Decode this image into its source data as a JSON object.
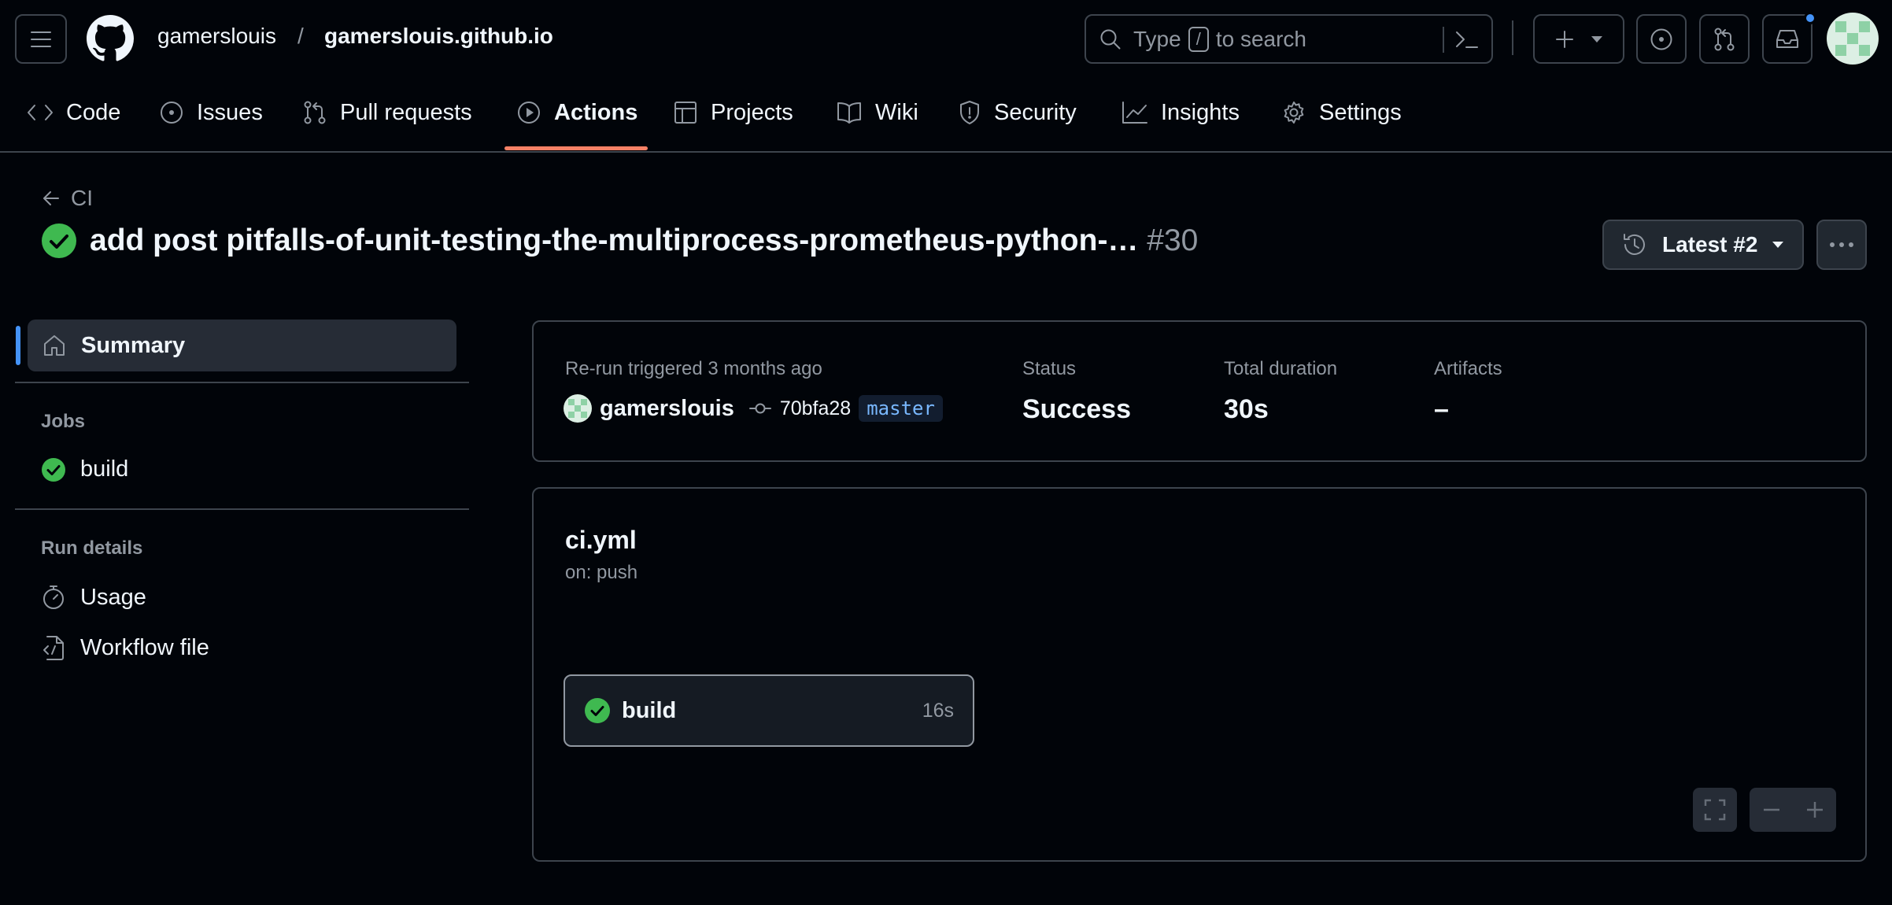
{
  "header": {
    "owner": "gamerslouis",
    "separator": "/",
    "repo": "gamerslouis.github.io",
    "search_prefix": "Type",
    "search_key": "/",
    "search_suffix": "to search"
  },
  "tabs": [
    {
      "label": "Code"
    },
    {
      "label": "Issues"
    },
    {
      "label": "Pull requests"
    },
    {
      "label": "Actions"
    },
    {
      "label": "Projects"
    },
    {
      "label": "Wiki"
    },
    {
      "label": "Security"
    },
    {
      "label": "Insights"
    },
    {
      "label": "Settings"
    }
  ],
  "run": {
    "back_label": "CI",
    "title": "add post pitfalls-of-unit-testing-the-multiprocess-prometheus-python-…",
    "number": "#30",
    "attempt_label": "Latest #2"
  },
  "sidebar": {
    "summary_label": "Summary",
    "jobs_heading": "Jobs",
    "jobs": [
      {
        "label": "build"
      }
    ],
    "details_heading": "Run details",
    "details": [
      {
        "label": "Usage"
      },
      {
        "label": "Workflow file"
      }
    ]
  },
  "summary": {
    "trigger_text": "Re-run triggered 3 months ago",
    "actor": "gamerslouis",
    "commit": "70bfa28",
    "branch": "master",
    "status_label": "Status",
    "status_value": "Success",
    "duration_label": "Total duration",
    "duration_value": "30s",
    "artifacts_label": "Artifacts",
    "artifacts_value": "–"
  },
  "workflow": {
    "file": "ci.yml",
    "trigger": "on: push",
    "jobs": [
      {
        "name": "build",
        "duration": "16s"
      }
    ]
  },
  "colors": {
    "success": "#3fb950",
    "accent": "#4493f8",
    "tab_underline": "#f78166",
    "notification_dot": "#4493f8"
  }
}
